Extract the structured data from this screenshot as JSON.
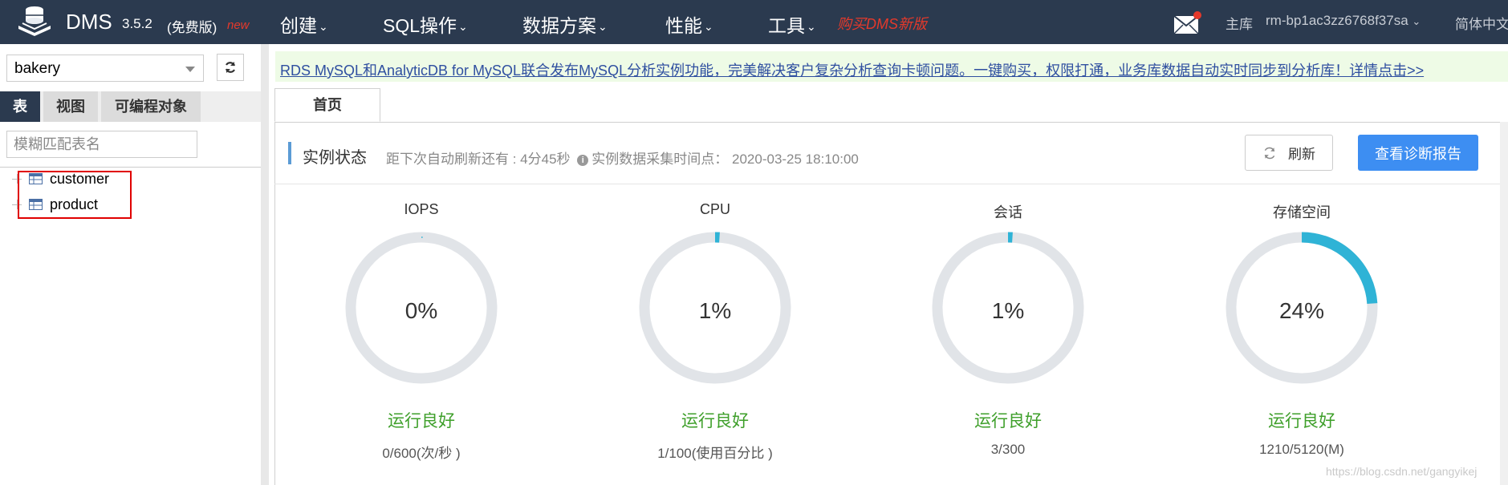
{
  "header": {
    "brand": "DMS",
    "version": "3.5.2",
    "edition": "(免费版)",
    "new_tag": "new",
    "nav": [
      {
        "label": "创建"
      },
      {
        "label": "SQL操作"
      },
      {
        "label": "数据方案"
      },
      {
        "label": "性能"
      },
      {
        "label": "工具"
      }
    ],
    "buy_link": "购买DMS新版",
    "main_lib_label": "主库",
    "instance_id": "rm-bp1ac3zz6768f37sa",
    "language": "简体中文"
  },
  "sidebar": {
    "database": "bakery",
    "tabs": [
      {
        "label": "表"
      },
      {
        "label": "视图"
      },
      {
        "label": "可编程对象"
      }
    ],
    "filter_placeholder": "模糊匹配表名",
    "tables": [
      {
        "name": "customer"
      },
      {
        "name": "product"
      }
    ]
  },
  "notice": {
    "text": "RDS MySQL和AnalyticDB for MySQL联合发布MySQL分析实例功能，完美解决客户复杂分析查询卡顿问题。一键购买，权限打通，业务库数据自动实时同步到分析库！详情点击>>"
  },
  "tabs": {
    "home": "首页"
  },
  "status": {
    "title": "实例状态",
    "refresh_countdown": "距下次自动刷新还有 : 4分45秒",
    "collect_time": "实例数据采集时间点： 2020-03-25 18:10:00",
    "refresh_button": "刷新",
    "report_button": "查看诊断报告"
  },
  "gauges": [
    {
      "title": "IOPS",
      "value_label": "0%",
      "percent": 0.3,
      "status": "运行良好",
      "detail": "0/600(次/秒 )"
    },
    {
      "title": "CPU",
      "value_label": "1%",
      "percent": 1,
      "status": "运行良好",
      "detail": "1/100(使用百分比 )"
    },
    {
      "title": "会话",
      "value_label": "1%",
      "percent": 1,
      "status": "运行良好",
      "detail": "3/300"
    },
    {
      "title": "存储空间",
      "value_label": "24%",
      "percent": 24,
      "status": "运行良好",
      "detail": "1210/5120(M)"
    }
  ],
  "colors": {
    "topbar": "#2b3a4f",
    "accent_blue": "#3d8ef2",
    "gauge_fill": "#2fb3d6",
    "gauge_track": "#e1e4e8",
    "status_ok": "#3e9f2a",
    "new_red": "#e5392b"
  },
  "watermark": "https://blog.csdn.net/gangyikej"
}
